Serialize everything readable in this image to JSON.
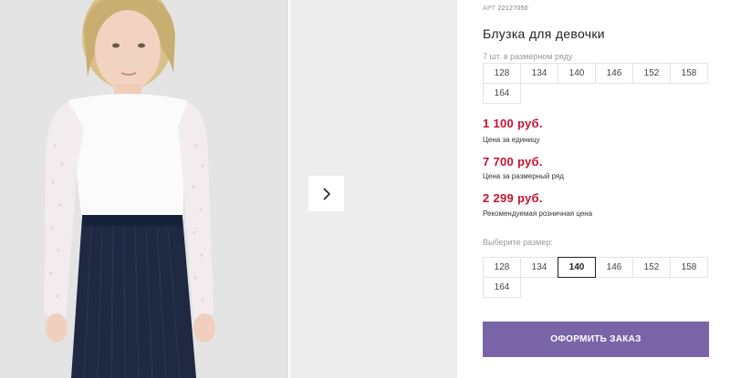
{
  "product": {
    "art_label": "АРТ",
    "art_code": "22127050",
    "title": "Блузка для девочки",
    "row_note": "7 шт. в размерном ряду"
  },
  "size_row": [
    "128",
    "134",
    "140",
    "146",
    "152",
    "158",
    "164"
  ],
  "prices": [
    {
      "value": "1 100 руб.",
      "label": "Цена за единицу"
    },
    {
      "value": "7 700 руб.",
      "label": "Цена за размерный ряд"
    },
    {
      "value": "2 299 руб.",
      "label": "Рекомендуемая розничная цена"
    }
  ],
  "size_picker": {
    "label": "Выберите размер:",
    "options": [
      "128",
      "134",
      "140",
      "146",
      "152",
      "158",
      "164"
    ],
    "selected": "140"
  },
  "order_button": "ОФОРМИТЬ ЗАКАЗ",
  "gallery": {
    "next_icon": "chevron-right-icon"
  },
  "colors": {
    "price": "#c8102e",
    "accent_button": "#7a64a8",
    "photo_bg": "#e6e6e6"
  }
}
